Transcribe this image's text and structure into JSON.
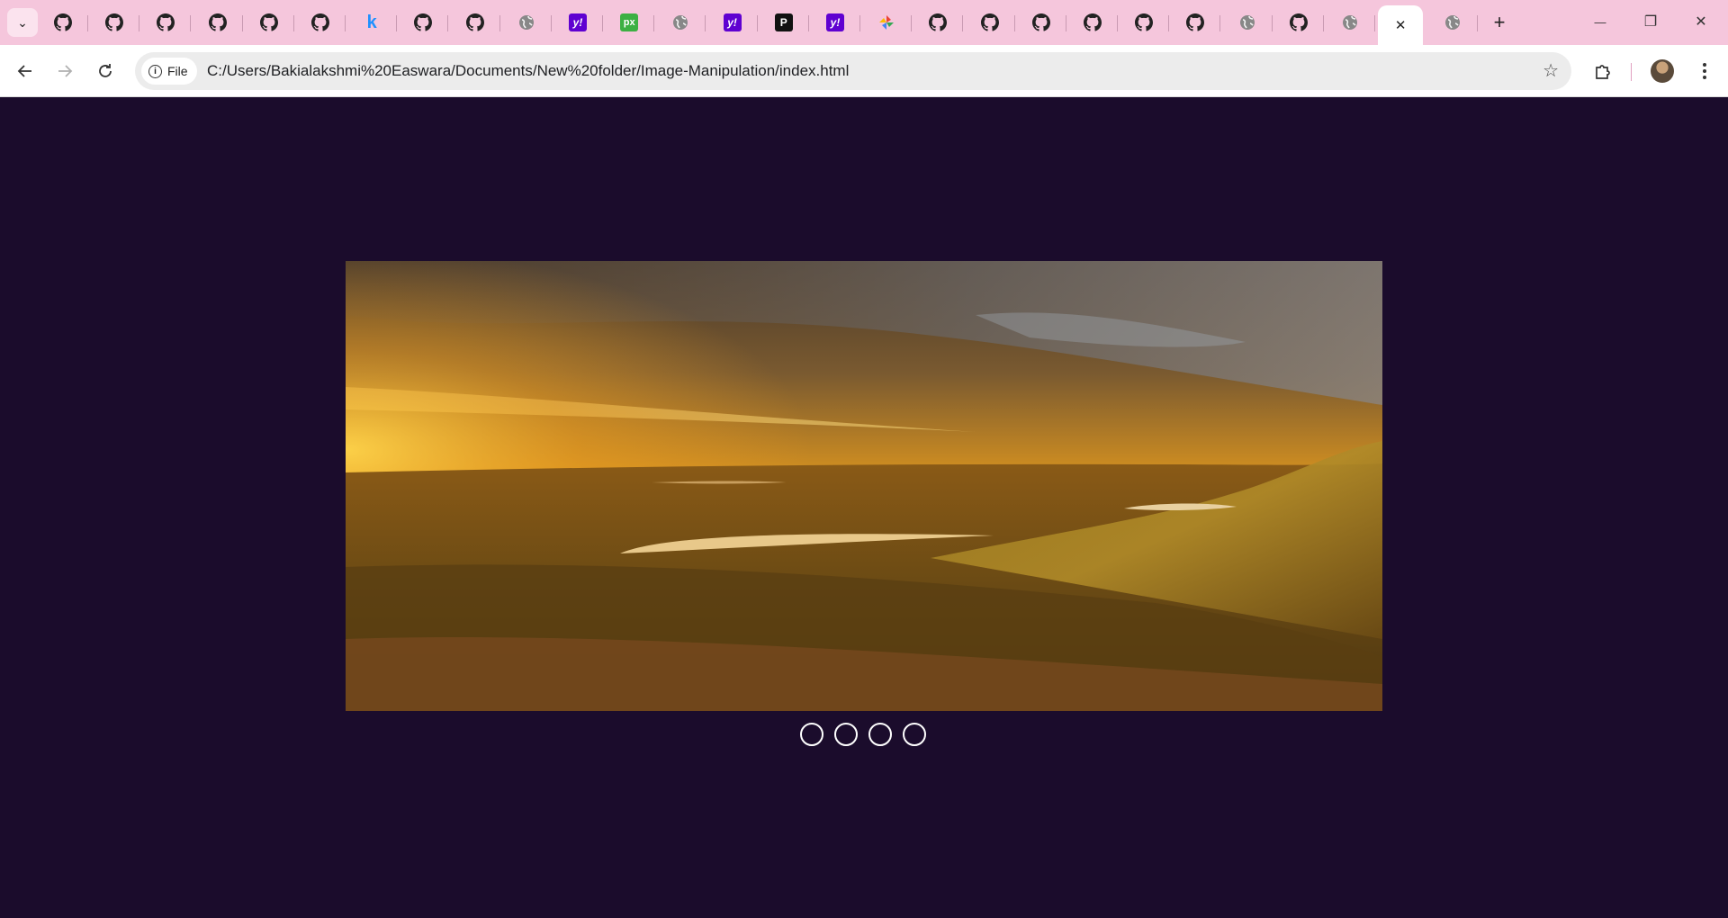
{
  "browser": {
    "tabs": [
      {
        "icon": "github-icon",
        "text": ""
      },
      {
        "icon": "github-icon",
        "text": ""
      },
      {
        "icon": "github-icon",
        "text": ""
      },
      {
        "icon": "github-icon",
        "text": ""
      },
      {
        "icon": "github-icon",
        "text": ""
      },
      {
        "icon": "github-icon",
        "text": ""
      },
      {
        "icon": "kaggle-icon",
        "text": "k"
      },
      {
        "icon": "github-icon",
        "text": ""
      },
      {
        "icon": "github-icon",
        "text": ""
      },
      {
        "icon": "globe-icon",
        "text": ""
      },
      {
        "icon": "yahoo-icon",
        "text": "y!"
      },
      {
        "icon": "px-icon",
        "text": "px"
      },
      {
        "icon": "globe-icon",
        "text": ""
      },
      {
        "icon": "yahoo-icon",
        "text": "y!"
      },
      {
        "icon": "p-logo-icon",
        "text": "P"
      },
      {
        "icon": "yahoo-icon",
        "text": "y!"
      },
      {
        "icon": "pinwheel-icon",
        "text": ""
      },
      {
        "icon": "github-icon",
        "text": ""
      },
      {
        "icon": "github-icon",
        "text": ""
      },
      {
        "icon": "github-icon",
        "text": ""
      },
      {
        "icon": "github-icon",
        "text": ""
      },
      {
        "icon": "github-icon",
        "text": ""
      },
      {
        "icon": "github-icon",
        "text": ""
      },
      {
        "icon": "globe-icon",
        "text": ""
      },
      {
        "icon": "github-icon",
        "text": ""
      },
      {
        "icon": "globe-icon",
        "text": ""
      },
      {
        "icon": "close-icon",
        "text": "✕",
        "active": true
      },
      {
        "icon": "globe-icon",
        "text": ""
      }
    ],
    "new_tab": "+",
    "window_controls": {
      "minimize": "—",
      "restore": "❐",
      "close": "✕"
    },
    "chip_label": "File",
    "url": "C:/Users/Bakialakshmi%20Easwara/Documents/New%20folder/Image-Manipulation/index.html"
  },
  "carousel": {
    "dot_count": 4,
    "active_index": 0
  },
  "colors": {
    "tabstrip": "#f5c6dc",
    "page_background": "#1b0c2c",
    "dot_border": "#ffffff"
  }
}
